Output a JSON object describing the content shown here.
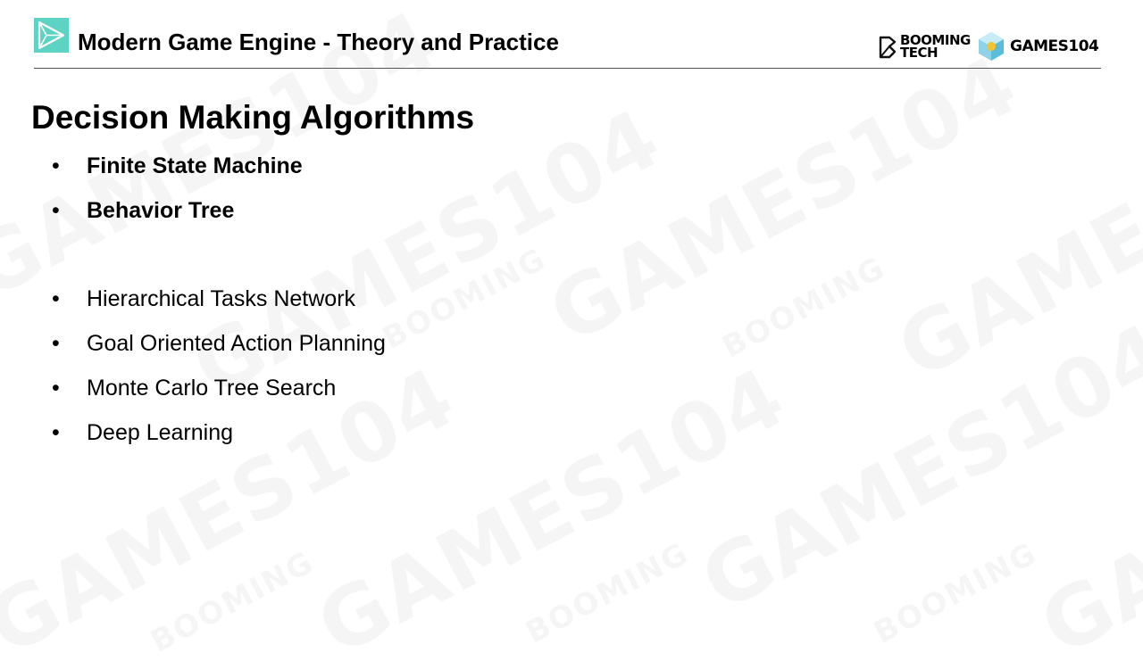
{
  "header": {
    "course_title": "Modern Game Engine - Theory and Practice",
    "brand_booming_line1": "BOOMING",
    "brand_booming_line2": "TECH",
    "brand_games": "GAMES104"
  },
  "slide": {
    "heading": "Decision Making Algorithms",
    "bullet_glyph": "•",
    "bullets": [
      {
        "label": "Finite State Machine"
      },
      {
        "label": "Behavior Tree"
      },
      {
        "label": "Hierarchical Tasks Network"
      },
      {
        "label": "Goal Oriented Action Planning"
      },
      {
        "label": "Monte Carlo Tree Search"
      },
      {
        "label": "Deep Learning"
      }
    ]
  },
  "colors": {
    "accent": "#5dd3c4",
    "text": "#000000",
    "rule": "#555555"
  }
}
